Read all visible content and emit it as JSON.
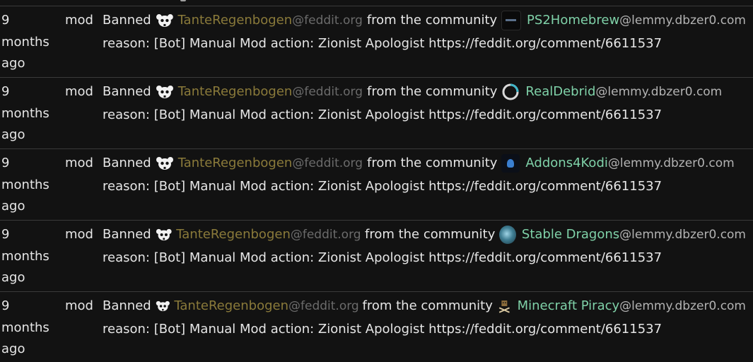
{
  "rows": [
    {
      "time": "9\nmonths\nago",
      "mod": "mod",
      "action": "Banned",
      "user_name": "TanteRegenbogen",
      "user_host": "@feddit.org",
      "connector": "from the community",
      "community_name": "PS2Homebrew",
      "community_host": "@lemmy.dbzer0.com",
      "community_icon": "ps2homebrew-community-icon",
      "reason": "reason: [Bot] Manual Mod action: Zionist Apologist https://feddit.org/comment/6611537"
    },
    {
      "time": "9\nmonths\nago",
      "mod": "mod",
      "action": "Banned",
      "user_name": "TanteRegenbogen",
      "user_host": "@feddit.org",
      "connector": "from the community",
      "community_name": "RealDebrid",
      "community_host": "@lemmy.dbzer0.com",
      "community_icon": "realdebrid-community-icon",
      "reason": "reason: [Bot] Manual Mod action: Zionist Apologist https://feddit.org/comment/6611537"
    },
    {
      "time": "9\nmonths\nago",
      "mod": "mod",
      "action": "Banned",
      "user_name": "TanteRegenbogen",
      "user_host": "@feddit.org",
      "connector": "from the community",
      "community_name": "Addons4Kodi",
      "community_host": "@lemmy.dbzer0.com",
      "community_icon": "addons4kodi-community-icon",
      "reason": "reason: [Bot] Manual Mod action: Zionist Apologist https://feddit.org/comment/6611537"
    },
    {
      "time": "9\nmonths\nago",
      "mod": "mod",
      "action": "Banned",
      "user_name": "TanteRegenbogen",
      "user_host": "@feddit.org",
      "connector": "from the community",
      "community_name": "Stable Dragons",
      "community_host": "@lemmy.dbzer0.com",
      "community_icon": "stable-dragons-community-icon",
      "reason": "reason: [Bot] Manual Mod action: Zionist Apologist https://feddit.org/comment/6611537"
    },
    {
      "time": "9\nmonths\nago",
      "mod": "mod",
      "action": "Banned",
      "user_name": "TanteRegenbogen",
      "user_host": "@feddit.org",
      "connector": "from the community",
      "community_name": "Minecraft Piracy",
      "community_host": "@lemmy.dbzer0.com",
      "community_icon": "minecraft-piracy-community-icon",
      "reason": "reason: [Bot] Manual Mod action: Zionist Apologist https://feddit.org/comment/6611537"
    }
  ],
  "colors": {
    "background": "#121212",
    "text": "#e6e6e6",
    "user_name": "#8a7a3a",
    "user_host": "#6b6b6b",
    "community_name": "#7fd1a8",
    "community_host": "#b3b3b3",
    "divider": "#3a3a3a"
  },
  "icons": {
    "user_avatar": "skull-bear-icon"
  }
}
